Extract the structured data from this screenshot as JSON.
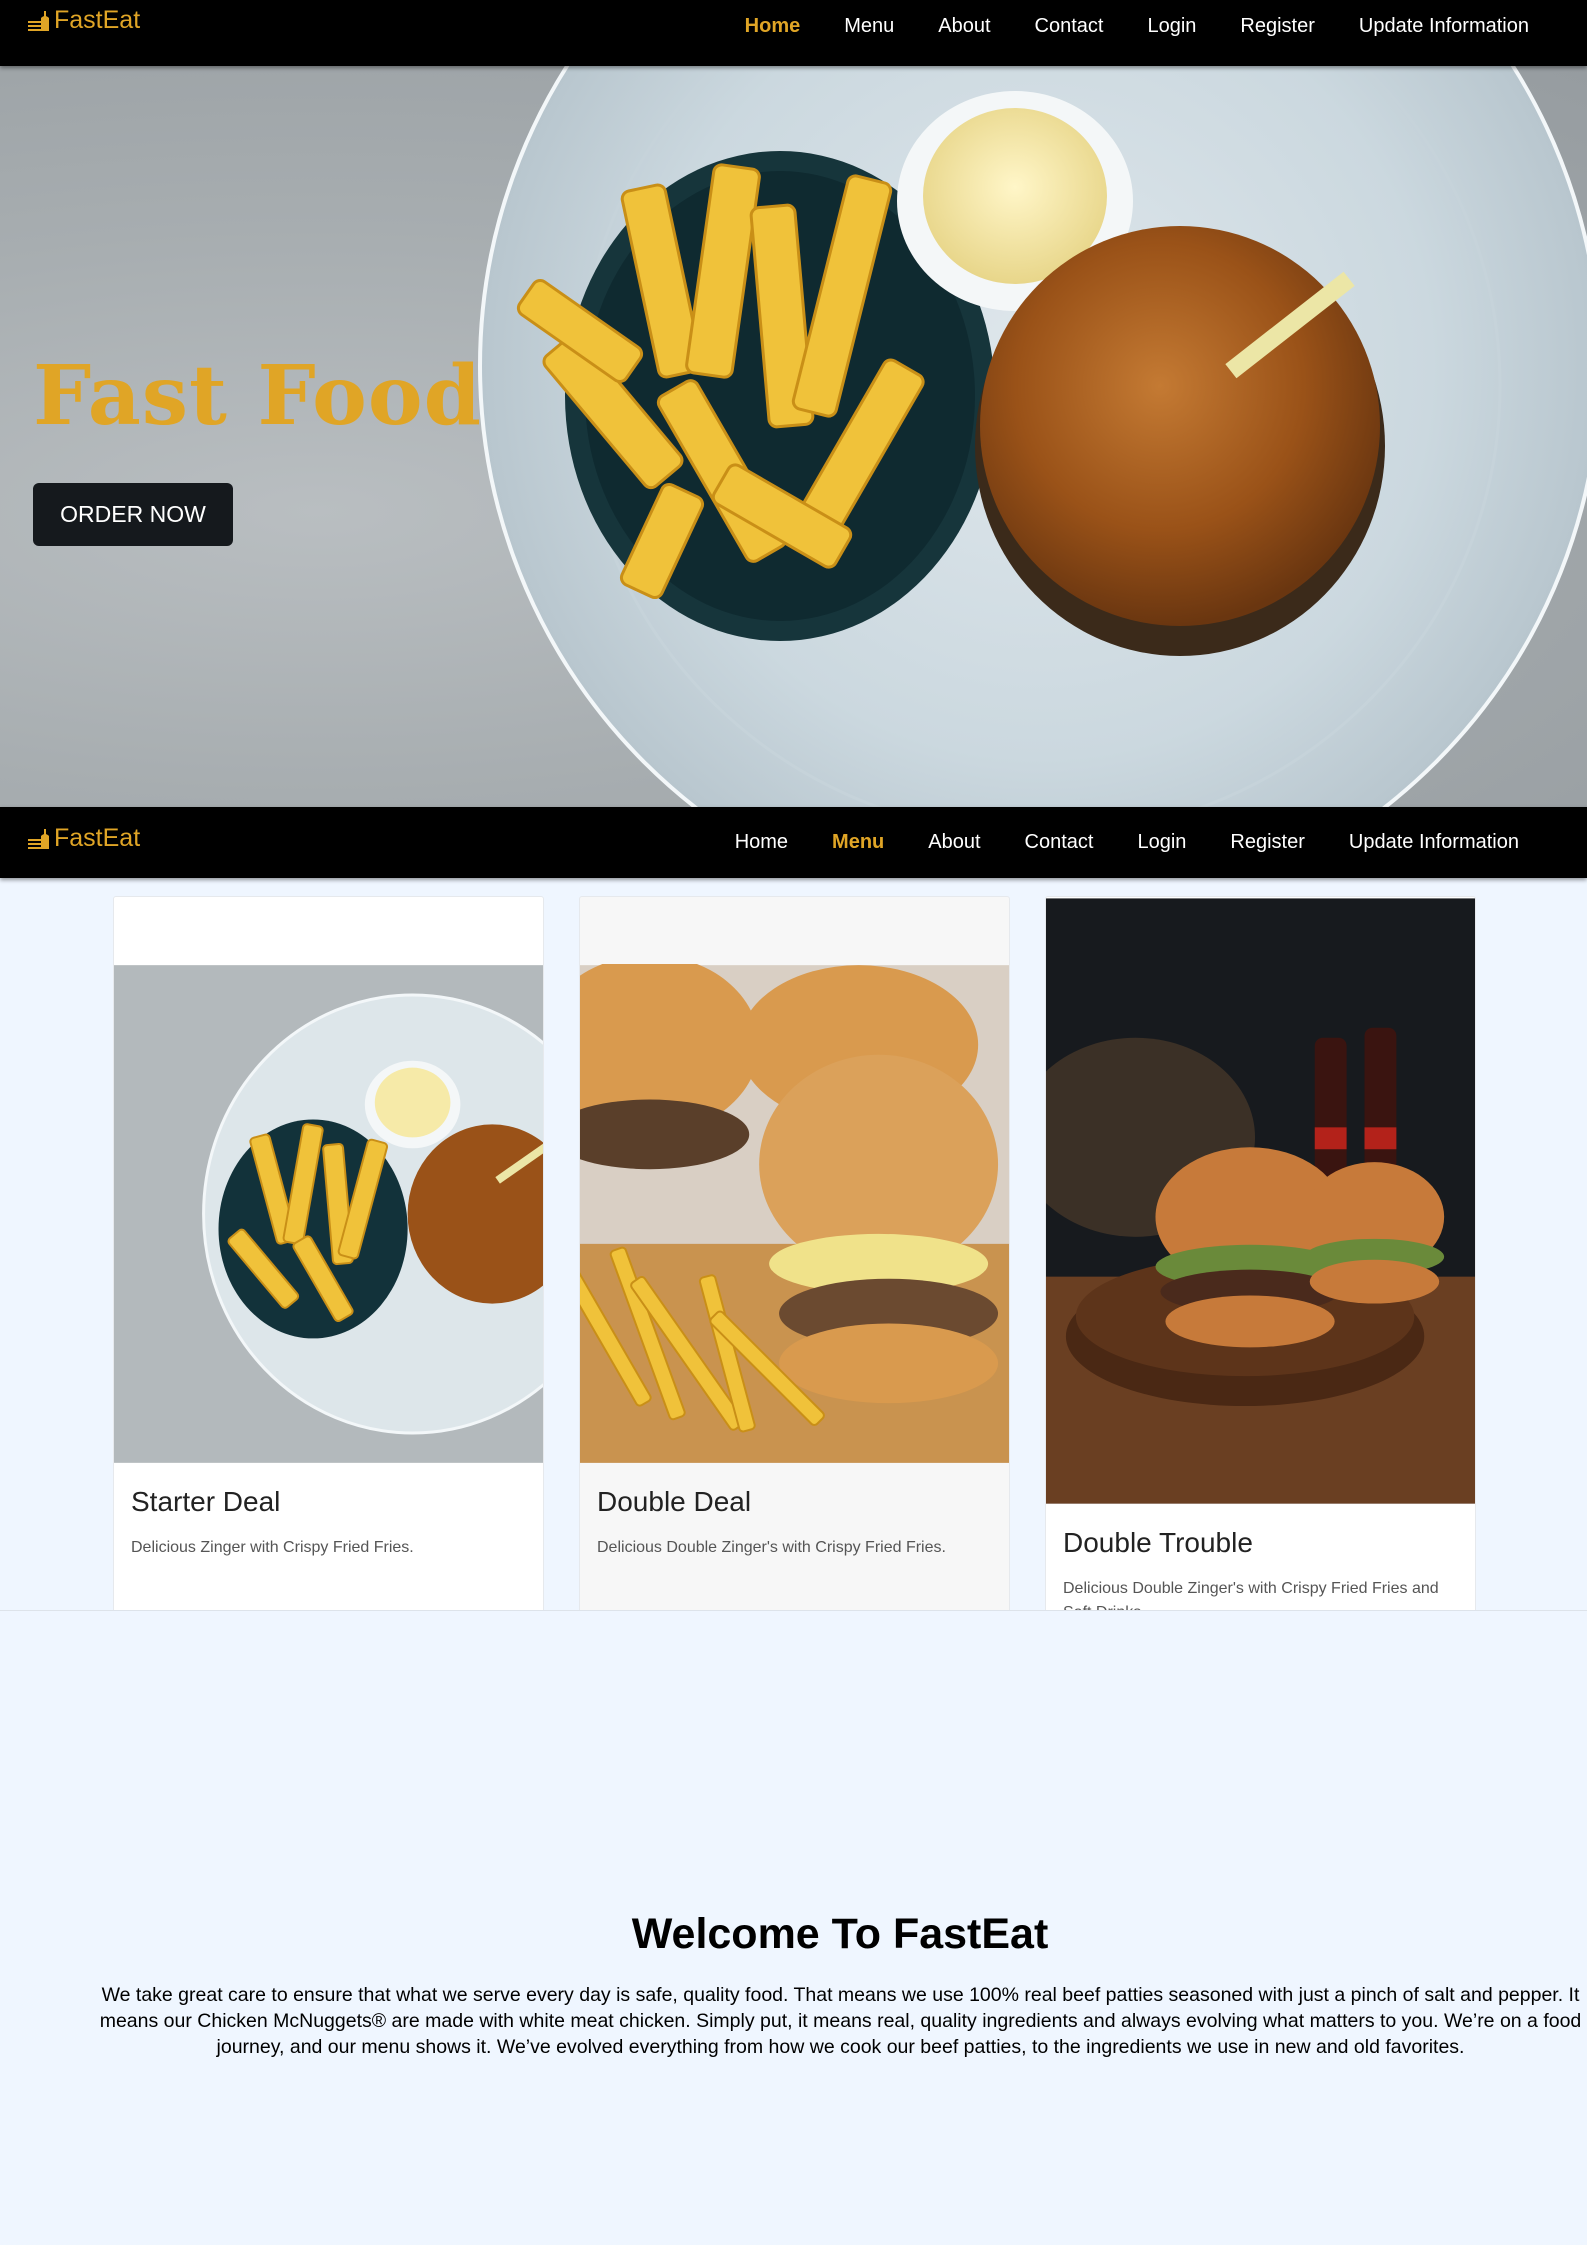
{
  "brand": {
    "name": "FastEat",
    "color": "#e0a526",
    "icon": "burger-stack-icon"
  },
  "nav_top": {
    "items": [
      "Home",
      "Menu",
      "About",
      "Contact",
      "Login",
      "Register",
      "Update Information"
    ],
    "active": "Home"
  },
  "hero": {
    "title": "Fast Food",
    "button": "ORDER NOW"
  },
  "nav_menu": {
    "items": [
      "Home",
      "Menu",
      "About",
      "Contact",
      "Login",
      "Register",
      "Update Information"
    ],
    "active": "Menu"
  },
  "cards": [
    {
      "title": "Starter Deal",
      "text": "Delicious Zinger with Crispy Fried Fries.",
      "image": "burger-and-fries-plate-photo"
    },
    {
      "title": "Double Deal",
      "text": "Delicious Double Zinger's with Crispy Fried Fries.",
      "image": "double-burger-fries-photo"
    },
    {
      "title": "Double Trouble",
      "text": "Delicious Double Zinger's with Crispy Fried Fries and Soft Drinks",
      "image": "burgers-and-cola-photo"
    }
  ],
  "welcome": {
    "title": "Welcome To FastEat",
    "text": "We take great care to ensure that what we serve every day is safe, quality food. That means we use 100% real beef patties seasoned with just a pinch of salt and pepper. It means our Chicken McNuggets® are made with white meat chicken. Simply put, it means real, quality ingredients and always evolving what matters to you. We’re on a food journey, and our menu shows it. We’ve evolved everything from how we cook our beef patties, to the ingredients we use in new and old favorites."
  }
}
